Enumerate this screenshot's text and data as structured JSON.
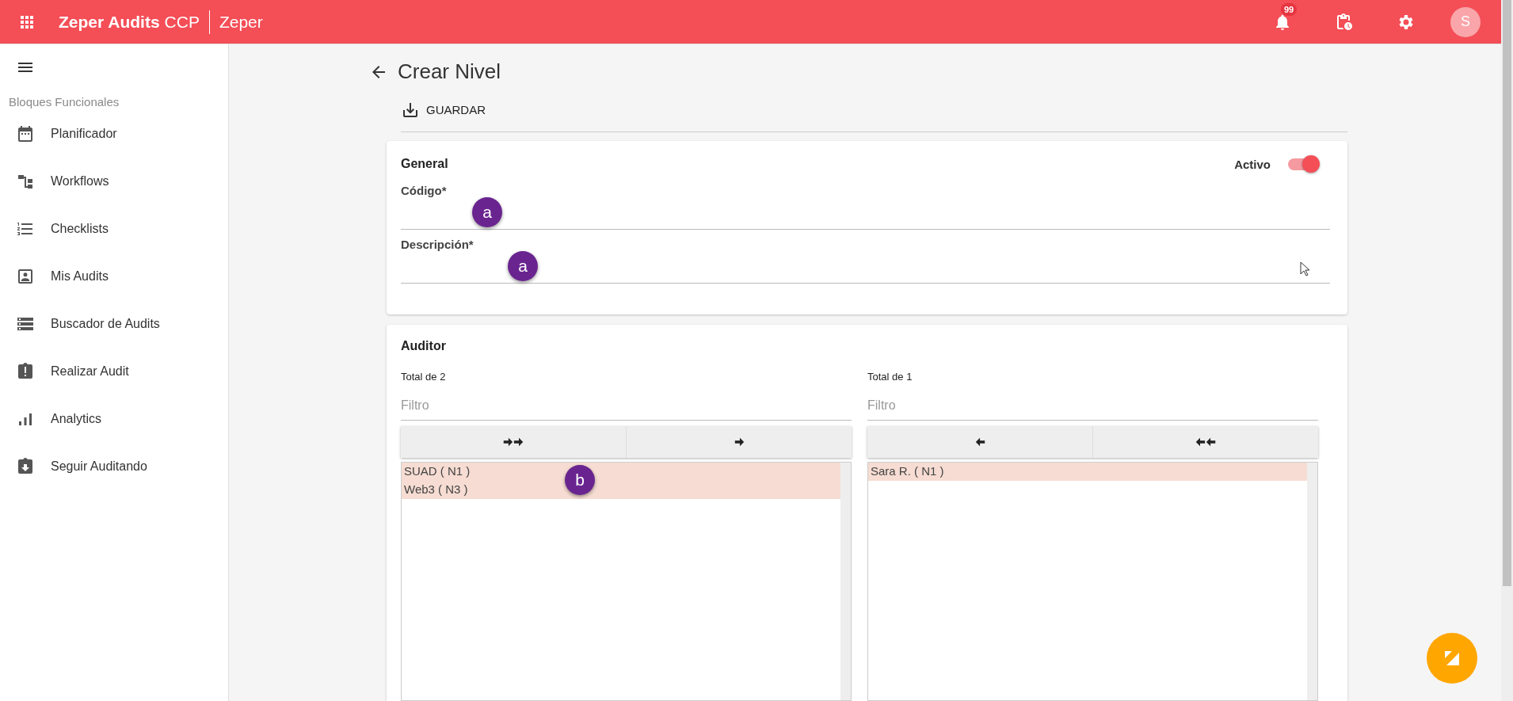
{
  "app_bar": {
    "title": "Zeper Audits",
    "subtitle": "CCP",
    "company": "Zeper",
    "notification_count": "99",
    "avatar_initial": "S"
  },
  "sidebar": {
    "section": "Bloques Funcionales",
    "items": [
      {
        "label": "Planificador",
        "kind": "calendar"
      },
      {
        "label": "Workflows",
        "kind": "workflow"
      },
      {
        "label": "Checklists",
        "kind": "numbered-list"
      },
      {
        "label": "Mis Audits",
        "kind": "portrait"
      },
      {
        "label": "Buscador de Audits",
        "kind": "storage"
      },
      {
        "label": "Realizar Audit",
        "kind": "clipboard-alert"
      },
      {
        "label": "Analytics",
        "kind": "bars"
      },
      {
        "label": "Seguir Auditando",
        "kind": "clipboard-down"
      }
    ]
  },
  "page": {
    "title": "Crear Nivel",
    "save_label": "GUARDAR"
  },
  "general": {
    "title": "General",
    "active_label": "Activo",
    "active": true,
    "fields": [
      {
        "label": "Código*",
        "marker": "a"
      },
      {
        "label": "Descripción*",
        "marker": "a"
      }
    ]
  },
  "auditor": {
    "title": "Auditor",
    "lists": [
      {
        "kind": "source",
        "total": "Total de 2",
        "filter_placeholder": "Filtro",
        "marker": "b",
        "items": [
          {
            "label": "SUAD ( N1 )",
            "selected": true
          },
          {
            "label": "Web3 ( N3 )",
            "selected": true
          }
        ]
      },
      {
        "kind": "target",
        "total": "Total de 1",
        "filter_placeholder": "Filtro",
        "items": [
          {
            "label": "Sara R. ( N1 )",
            "selected": true
          }
        ]
      }
    ]
  }
}
